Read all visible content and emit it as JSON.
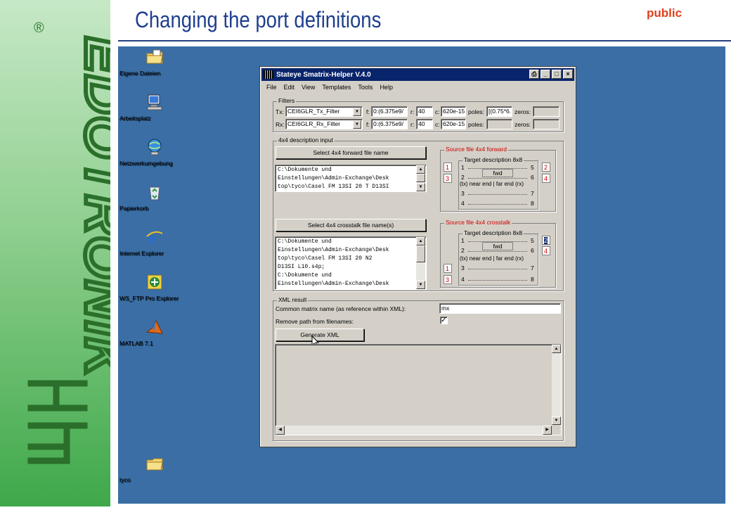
{
  "slide": {
    "title": "Changing the port definitions",
    "classification": "public",
    "logo_text": "EDOTRONIK",
    "registered_mark": "®"
  },
  "desktop_icons": [
    {
      "label": "Eigene Dateien",
      "icon": "folder-documents-icon"
    },
    {
      "label": "Arbeitsplatz",
      "icon": "computer-icon"
    },
    {
      "label": "Netzwerkumgebung",
      "icon": "network-icon"
    },
    {
      "label": "Papierkorb",
      "icon": "recycle-bin-icon"
    },
    {
      "label": "Internet Explorer",
      "icon": "internet-explorer-icon"
    },
    {
      "label": "WS_FTP Pro Explorer",
      "icon": "ftp-icon"
    },
    {
      "label": "MATLAB 7.1",
      "icon": "matlab-icon"
    },
    {
      "label": "tyco",
      "icon": "folder-icon"
    }
  ],
  "window": {
    "title": "Stateye Smatrix-Helper V.4.0",
    "menu": [
      "File",
      "Edit",
      "View",
      "Templates",
      "Tools",
      "Help"
    ],
    "filters": {
      "legend": "Filters",
      "tx": {
        "label": "Tx:",
        "filter": "CEI6GLR_Tx_Filter",
        "f_label": "f:",
        "f": "0:(6.375e9/",
        "r_label": "r:",
        "r": "40",
        "c_label": "c:",
        "c": "620e-15",
        "poles_label": "poles:",
        "poles": "[(0.75*6.",
        "zeros_label": "zeros:",
        "zeros": ""
      },
      "rx": {
        "label": "Rx:",
        "filter": "CEI6GLR_Rx_Filter",
        "f_label": "f:",
        "f": "0:(6.375e9/",
        "r_label": "r:",
        "r": "40",
        "c_label": "c:",
        "c": "620e-15",
        "poles_label": "poles:",
        "poles": "",
        "zeros_label": "zeros:",
        "zeros": ""
      }
    },
    "description": {
      "legend": "4x4 description input",
      "forward_button": "Select 4x4 forward file name",
      "forward_text": [
        "C:\\Dokumente und",
        "Einstellungen\\Admin-Exchange\\Desk",
        "top\\tyco\\Casel FM 13SI 20 T D13SI"
      ],
      "crosstalk_button": "Select 4x4 crosstalk file name(s)",
      "crosstalk_text": [
        "C:\\Dokumente und",
        "Einstellungen\\Admin-Exchange\\Desk",
        "top\\tyco\\Casel FM 13SI 20 N2",
        "D13SI L10.s4p;",
        "C:\\Dokumente und",
        "Einstellungen\\Admin-Exchange\\Desk"
      ]
    },
    "src_forward": {
      "legend": "Source file 4x4 forward",
      "target_legend": "Target description 8x8",
      "left_ports": [
        "1",
        "3"
      ],
      "right_ports": [
        "2",
        "4"
      ],
      "rows": [
        {
          "l": "1",
          "r": "5"
        },
        {
          "l": "2",
          "r": "6"
        },
        {
          "l": "3",
          "r": "7"
        },
        {
          "l": "4",
          "r": "8"
        }
      ],
      "fwd": "fwd",
      "ends": "(tx) near end  |  far end (rx)"
    },
    "src_crosstalk": {
      "legend": "Source file 4x4 crosstalk",
      "target_legend": "Target description 8x8",
      "left_ports": [
        "1",
        "3"
      ],
      "right_ports": [
        "2",
        "4"
      ],
      "rows": [
        {
          "l": "1",
          "r": "5"
        },
        {
          "l": "2",
          "r": "6"
        },
        {
          "l": "3",
          "r": "7"
        },
        {
          "l": "4",
          "r": "8"
        }
      ],
      "fwd": "fwd",
      "ends": "(tx) near end  |  far end (rx)"
    },
    "xml": {
      "legend": "XML result",
      "matrix_label": "Common matrix name (as reference within XML):",
      "matrix_value": "mx",
      "remove_path_label": "Remove path from filenames:",
      "remove_path_checked": "✓",
      "generate_button": "Generate XML",
      "output": ""
    }
  }
}
